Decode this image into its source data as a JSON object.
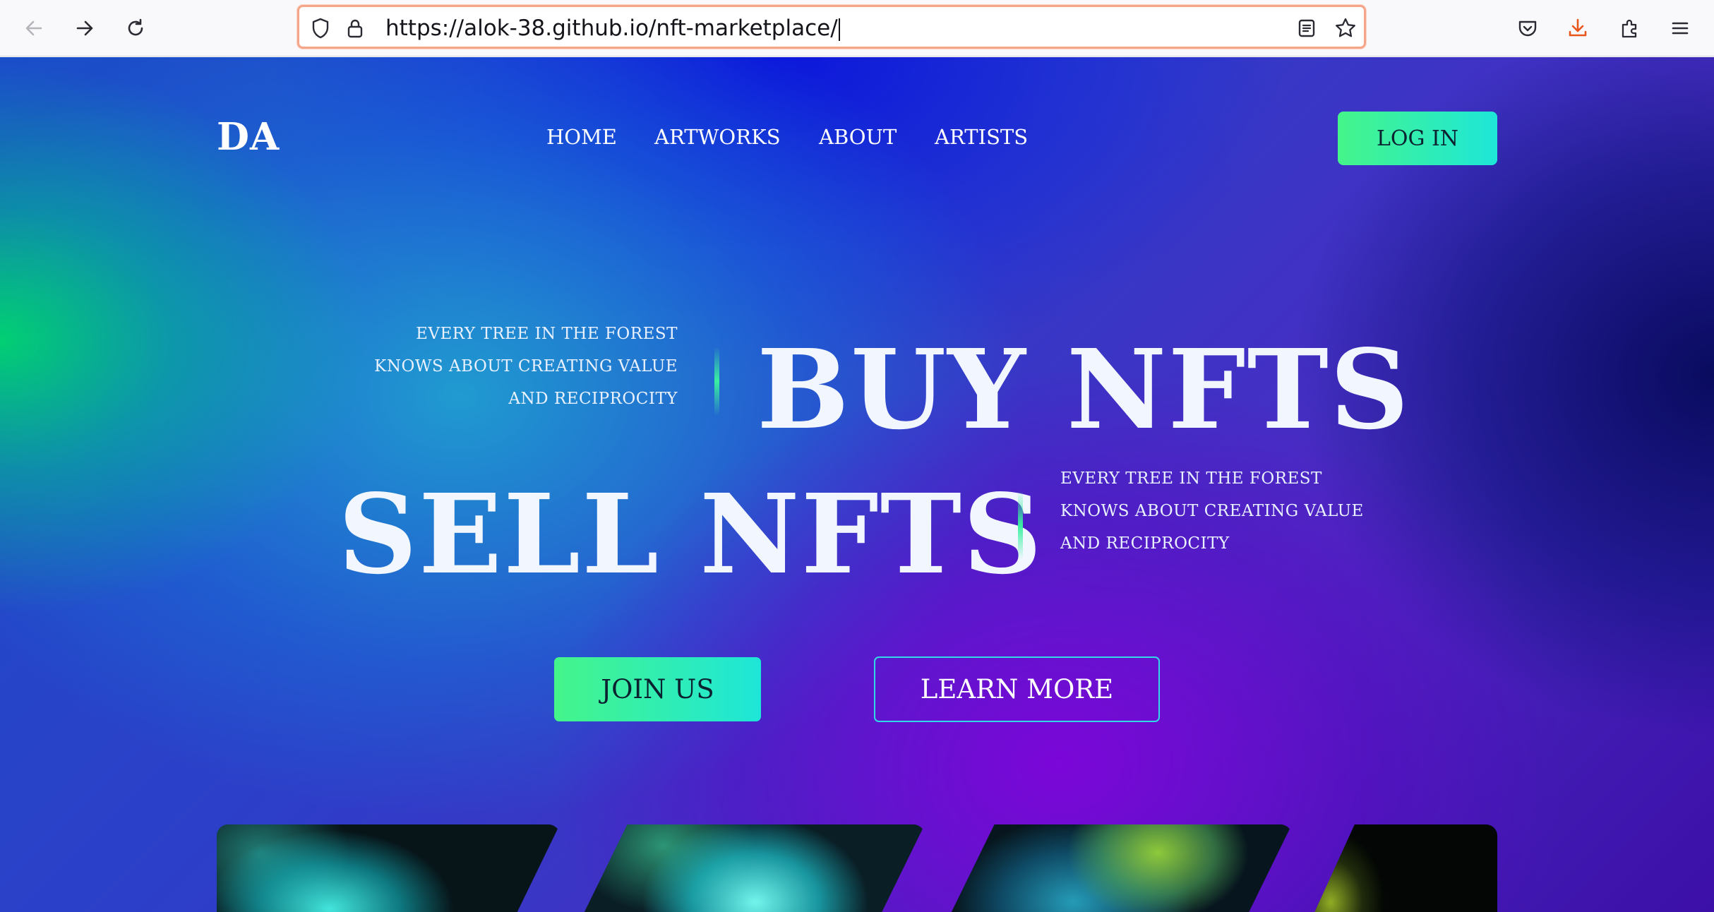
{
  "browser": {
    "url": "https://alok-38.github.io/nft-marketplace/",
    "icons": {
      "back": "back-arrow-icon",
      "forward": "forward-arrow-icon",
      "reload": "reload-icon",
      "tracking": "shield-icon",
      "lock": "lock-icon",
      "reader": "reader-view-icon",
      "bookmark": "star-icon",
      "pocket": "pocket-icon",
      "downloads": "download-icon",
      "extensions": "puzzle-icon",
      "menu": "hamburger-menu-icon"
    },
    "colors": {
      "download_accent": "#e8561b",
      "url_focus": "#f4a58a"
    }
  },
  "site": {
    "logo": "DA",
    "nav": [
      "HOME",
      "ARTWORKS",
      "ABOUT",
      "ARTISTS"
    ],
    "login_label": "LOG IN",
    "hero": {
      "tagline_1": [
        "EVERY TREE IN THE FOREST",
        "KNOWS ABOUT CREATING VALUE",
        "AND RECIPROCITY"
      ],
      "headline_1": "BUY NFTS",
      "headline_2": "SELL NFTS",
      "tagline_2": [
        "EVERY TREE IN THE FOREST",
        "KNOWS ABOUT CREATING VALUE",
        "AND RECIPROCITY"
      ]
    },
    "cta_primary": "JOIN US",
    "cta_secondary": "LEARN MORE",
    "colors": {
      "button_gradient_start": "#45f58a",
      "button_gradient_end": "#1ee6d8",
      "outline_button_border": "#31d9e6"
    },
    "cards": [
      "nft-card-1",
      "nft-card-2",
      "nft-card-3",
      "nft-card-4"
    ]
  }
}
